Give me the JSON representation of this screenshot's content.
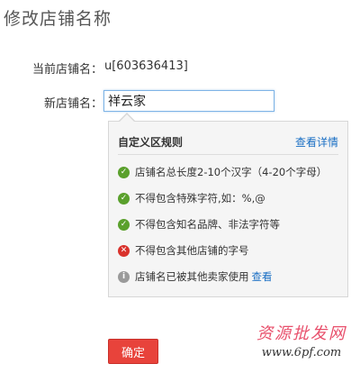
{
  "page": {
    "title": "修改店铺名称"
  },
  "form": {
    "current_label": "当前店铺名：",
    "current_value": "u[603636413]",
    "new_label": "新店铺名：",
    "new_value": "祥云家"
  },
  "rules": {
    "title": "自定义区规则",
    "detail_link": "查看详情",
    "items": [
      {
        "status": "ok",
        "text": "店铺名总长度2-10个汉字（4-20个字母）"
      },
      {
        "status": "ok",
        "text": "不得包含特殊字符,如：%,@"
      },
      {
        "status": "ok",
        "text": "不得包含知名品牌、非法字符等"
      },
      {
        "status": "error",
        "text": "不得包含其他店铺的字号"
      },
      {
        "status": "info",
        "text": "店铺名已被其他卖家使用",
        "link": "查看"
      }
    ]
  },
  "actions": {
    "confirm_label": "确定"
  },
  "watermark": {
    "title": "资源批发网",
    "url": "www.6pf.com"
  },
  "colors": {
    "ok": "#5aa02c",
    "error": "#d9322c",
    "info": "#9a9a9a",
    "link": "#1a6fc4",
    "confirm": "#e8433b"
  },
  "icons": {
    "ok": "check-circle-icon",
    "error": "x-circle-icon",
    "info": "info-circle-icon"
  }
}
